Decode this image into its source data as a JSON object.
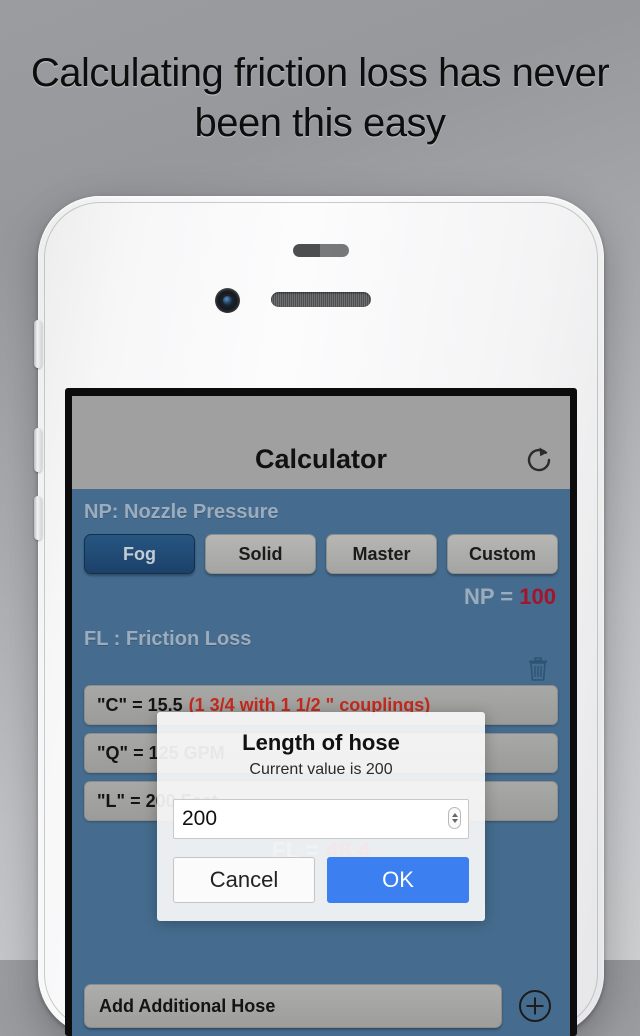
{
  "headline": "Calculating friction loss has never been this easy",
  "phone": {
    "hardware": {
      "camera": "front-camera",
      "earpiece": "earpiece-speaker",
      "sensor": "proximity-sensor",
      "silent_switch": "silent-switch",
      "volume_up": "volume-up-button",
      "volume_down": "volume-down-button"
    }
  },
  "app": {
    "navbar": {
      "title": "Calculator",
      "refresh_icon": "refresh-icon"
    },
    "np_section": {
      "label": "NP: Nozzle Pressure",
      "buttons": [
        {
          "label": "Fog",
          "selected": true
        },
        {
          "label": "Solid",
          "selected": false
        },
        {
          "label": "Master",
          "selected": false
        },
        {
          "label": "Custom",
          "selected": false
        }
      ],
      "result_prefix": "NP = ",
      "result_value": "100"
    },
    "fl_section": {
      "label": "FL : Friction Loss",
      "trash_icon": "trash-icon",
      "rows": [
        {
          "text": "\"C\" = 15.5 ",
          "red": "(1 3/4 with 1 1/2 \" couplings)"
        },
        {
          "text": "\"Q\" = 125 GPM",
          "red": ""
        },
        {
          "text": "\"L\" = 200 Feet",
          "red": ""
        }
      ],
      "result_prefix": "FL = ",
      "result_value": "48.4"
    },
    "bottom": {
      "add_label": "Add Additional Hose",
      "plus_icon": "plus-circle-icon"
    }
  },
  "dialog": {
    "title": "Length of hose",
    "subtitle": "Current value is 200",
    "input_value": "200",
    "input_placeholder": "",
    "cancel_label": "Cancel",
    "ok_label": "OK"
  },
  "colors": {
    "accent_blue": "#456c8e",
    "selected_button": "#1f4a73",
    "red_value": "#a4142a",
    "red_text": "#c42a1d",
    "ok_button": "#3b7ff0",
    "navbar_gray": "#a0a0a0"
  }
}
